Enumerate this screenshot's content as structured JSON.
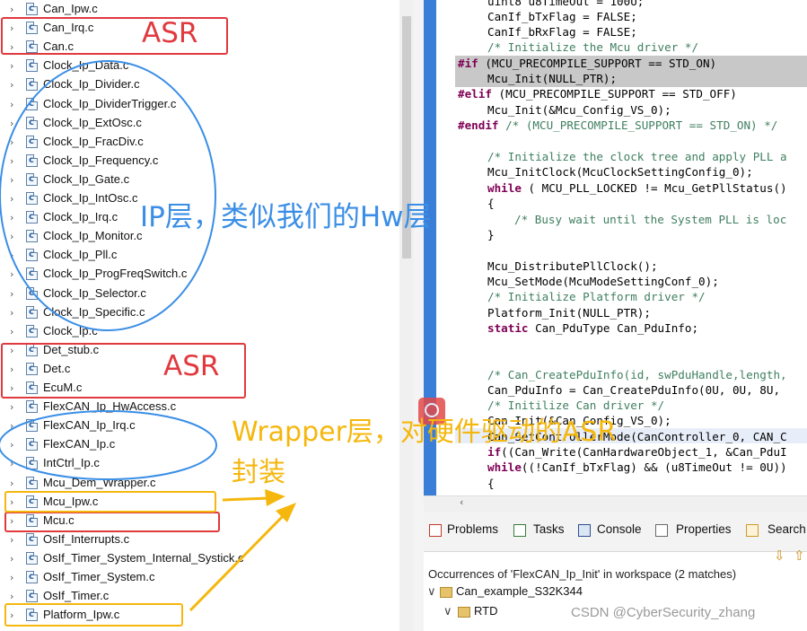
{
  "files": [
    {
      "name": "Can_Ipw.c"
    },
    {
      "name": "Can_Irq.c"
    },
    {
      "name": "Can.c"
    },
    {
      "name": "Clock_Ip_Data.c"
    },
    {
      "name": "Clock_Ip_Divider.c"
    },
    {
      "name": "Clock_Ip_DividerTrigger.c"
    },
    {
      "name": "Clock_Ip_ExtOsc.c"
    },
    {
      "name": "Clock_Ip_FracDiv.c"
    },
    {
      "name": "Clock_Ip_Frequency.c"
    },
    {
      "name": "Clock_Ip_Gate.c"
    },
    {
      "name": "Clock_Ip_IntOsc.c"
    },
    {
      "name": "Clock_Ip_Irq.c"
    },
    {
      "name": "Clock_Ip_Monitor.c"
    },
    {
      "name": "Clock_Ip_Pll.c"
    },
    {
      "name": "Clock_Ip_ProgFreqSwitch.c"
    },
    {
      "name": "Clock_Ip_Selector.c"
    },
    {
      "name": "Clock_Ip_Specific.c"
    },
    {
      "name": "Clock_Ip.c"
    },
    {
      "name": "Det_stub.c"
    },
    {
      "name": "Det.c"
    },
    {
      "name": "EcuM.c"
    },
    {
      "name": "FlexCAN_Ip_HwAccess.c"
    },
    {
      "name": "FlexCAN_Ip_Irq.c"
    },
    {
      "name": "FlexCAN_Ip.c"
    },
    {
      "name": "IntCtrl_Ip.c"
    },
    {
      "name": "Mcu_Dem_Wrapper.c"
    },
    {
      "name": "Mcu_Ipw.c"
    },
    {
      "name": "Mcu.c"
    },
    {
      "name": "OsIf_Interrupts.c"
    },
    {
      "name": "OsIf_Timer_System_Internal_Systick.c"
    },
    {
      "name": "OsIf_Timer_System.c"
    },
    {
      "name": "OsIf_Timer.c"
    },
    {
      "name": "Platform_Ipw.c"
    }
  ],
  "code": {
    "l1": "uint8 u8TimeOut = 100U;",
    "l2": "CanIf_bTxFlag = FALSE;",
    "l3": "CanIf_bRxFlag = FALSE;",
    "l4": "/* Initialize the Mcu driver */",
    "l5a": "#if",
    "l5b": " (MCU_PRECOMPILE_SUPPORT == STD_ON)",
    "l6": "Mcu_Init(NULL_PTR);",
    "l7a": "#elif",
    "l7b": " (MCU_PRECOMPILE_SUPPORT == STD_OFF)",
    "l8": "Mcu_Init(&Mcu_Config_VS_0);",
    "l9a": "#endif",
    "l9b": " /* (MCU_PRECOMPILE_SUPPORT == STD_ON) */",
    "l10": "/* Initialize the clock tree and apply PLL a",
    "l11": "Mcu_InitClock(McuClockSettingConfig_0);",
    "l12a": "while",
    "l12b": " ( MCU_PLL_LOCKED != Mcu_GetPllStatus()",
    "l13": "{",
    "l14": "/* Busy wait until the System PLL is loc",
    "l15": "}",
    "l16": "Mcu_DistributePllClock();",
    "l17": "Mcu_SetMode(McuModeSettingConf_0);",
    "l18": "/* Initialize Platform driver */",
    "l19": "Platform_Init(NULL_PTR);",
    "l20a": "static",
    "l20b": " Can_PduType Can_PduInfo;",
    "l21": "/* Can_CreatePduInfo(id, swPduHandle,length,",
    "l22": "Can_PduInfo = Can_CreatePduInfo(0U, 0U, 8U,",
    "l23": "/* Initilize Can driver */",
    "l24": "Can_Init(&Can_Config_VS_0);",
    "l25": "Can_SetControllerMode(CanController_0, CAN_C",
    "l26a": "if",
    "l26b": "((Can_Write(CanHardwareObject_1, &Can_PduI",
    "l27a": "while",
    "l27b": "((!CanIf_bTxFlag) && (u8TimeOut != 0U))",
    "l28": "{"
  },
  "panel": {
    "tabs": [
      "Problems",
      "Tasks",
      "Console",
      "Properties",
      "Search"
    ],
    "occurrences": "Occurrences of 'FlexCAN_Ip_Init' in workspace (2 matches)",
    "project": "Can_example_S32K344",
    "folder": "RTD"
  },
  "annotations": {
    "asr1": "ASR",
    "ip_layer": "IP层，类似我们的Hw层",
    "asr2": "ASR",
    "wrapper1": "Wrapper层，对硬件驱动的ASR",
    "wrapper2": "封装"
  },
  "watermark": "CSDN @CyberSecurity_zhang",
  "colors": {
    "annotation_red": "#e0393e",
    "annotation_blue": "#3a8ee6",
    "annotation_yellow": "#f5b70d"
  }
}
